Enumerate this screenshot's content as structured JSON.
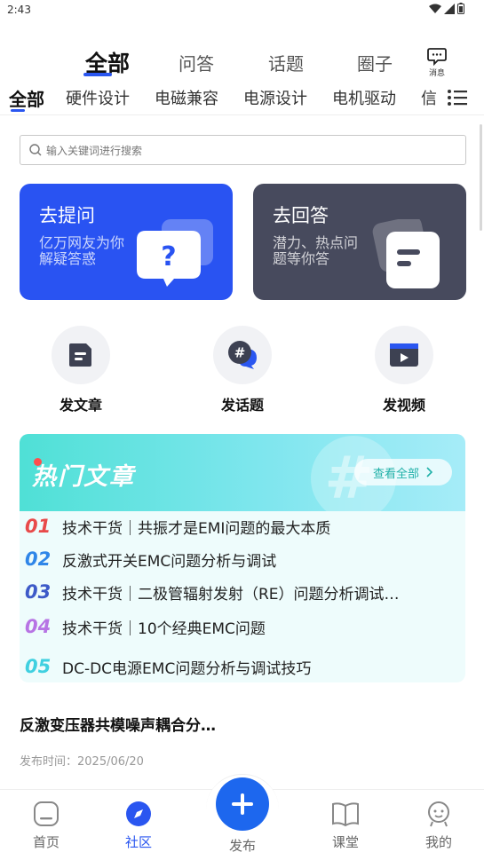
{
  "status_bar": {
    "time": "2:43"
  },
  "top_tabs": {
    "items": [
      {
        "label": "全部",
        "active": true
      },
      {
        "label": "问答",
        "active": false
      },
      {
        "label": "话题",
        "active": false
      },
      {
        "label": "圈子",
        "active": false
      }
    ],
    "messages_label": "消息"
  },
  "categories": {
    "items": [
      "全部",
      "硬件设计",
      "电磁兼容",
      "电源设计",
      "电机驱动",
      "信"
    ],
    "active_index": 0
  },
  "search": {
    "placeholder": "输入关键词进行搜索"
  },
  "cards": {
    "ask": {
      "title": "去提问",
      "subtitle": "亿万网友为你解疑答惑",
      "color": "#2953f2"
    },
    "answer": {
      "title": "去回答",
      "subtitle": "潜力、热点问题等你答",
      "color": "#474a5d"
    }
  },
  "actions": [
    {
      "label": "发文章",
      "icon": "article-icon"
    },
    {
      "label": "发话题",
      "icon": "topic-icon"
    },
    {
      "label": "发视频",
      "icon": "video-icon"
    }
  ],
  "hot_articles": {
    "title": "热门文章",
    "view_all": "查看全部",
    "items": [
      {
        "num": "01",
        "text": "技术干货｜共振才是EMI问题的最大本质",
        "color": "#e84a4a"
      },
      {
        "num": "02",
        "text": "反激式开关EMC问题分析与调试",
        "color": "#2f86e8"
      },
      {
        "num": "03",
        "text": "技术干货｜二极管辐射发射（RE）问题分析调试…",
        "color": "#3d5ac8"
      },
      {
        "num": "04",
        "text": "技术干货｜10个经典EMC问题",
        "color": "#b774e4"
      },
      {
        "num": "05",
        "text": "DC-DC电源EMC问题分析与调试技巧",
        "color": "#3fd0e0"
      }
    ]
  },
  "post": {
    "title": "反激变压器共模噪声耦合分…",
    "date": "发布时间：2025/06/20"
  },
  "bottom_nav": {
    "items": [
      {
        "label": "首页",
        "icon": "home-icon"
      },
      {
        "label": "社区",
        "icon": "compass-icon",
        "active": true
      },
      {
        "label": "发布",
        "icon": "plus-icon"
      },
      {
        "label": "课堂",
        "icon": "book-icon"
      },
      {
        "label": "我的",
        "icon": "profile-icon"
      }
    ],
    "accent": "#2a56f0"
  }
}
